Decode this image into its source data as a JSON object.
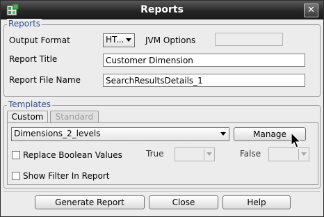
{
  "window": {
    "title": "Reports",
    "close_glyph": "✕"
  },
  "reports_group": {
    "legend": "Reports",
    "output_format_label": "Output Format",
    "output_format_value": "HT...",
    "jvm_options_label": "JVM Options",
    "jvm_options_value": "",
    "report_title_label": "Report Title",
    "report_title_value": "Customer Dimension",
    "report_file_name_label": "Report File Name",
    "report_file_name_value": "SearchResultsDetails_1"
  },
  "templates_group": {
    "legend": "Templates",
    "tabs": [
      {
        "label": "Custom",
        "active": true
      },
      {
        "label": "Standard",
        "active": false
      }
    ],
    "template_value": "Dimensions_2_levels",
    "manage_label": "Manage",
    "replace_boolean_label": "Replace Boolean Values",
    "true_label": "True",
    "false_label": "False",
    "show_filter_label": "Show Filter In Report"
  },
  "buttons": {
    "generate": "Generate Report",
    "close": "Close",
    "help": "Help"
  },
  "icons": {
    "app": "report-app-icon",
    "cursor": "mouse-pointer-icon"
  },
  "colors": {
    "legend": "#2a4f8e",
    "titlebar": "#262626"
  }
}
